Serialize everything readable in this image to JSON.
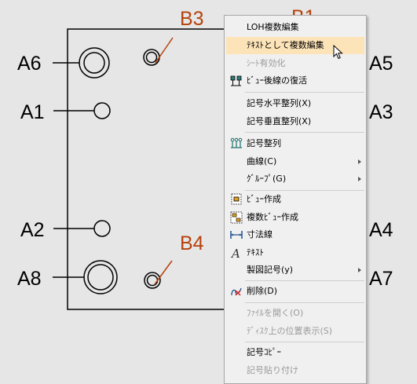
{
  "drawing": {
    "labels": {
      "a6": "A6",
      "a1": "A1",
      "a2": "A2",
      "a8": "A8",
      "a5": "A5",
      "a3": "A3",
      "a4": "A4",
      "a7": "A7",
      "b3": "B3",
      "b1": "B1",
      "b4": "B4"
    }
  },
  "menu": {
    "items": [
      {
        "label": "LOH複数編集",
        "state": "normal",
        "icon": "none",
        "submenu": false
      },
      {
        "label": "ﾃｷｽﾄとして複数編集",
        "state": "highlighted",
        "icon": "none",
        "submenu": false
      },
      {
        "label": "ｼｰﾄ有効化",
        "state": "disabled",
        "icon": "none",
        "submenu": false
      },
      {
        "label": "ﾋﾞｭｰ後線の復活",
        "state": "normal",
        "icon": "restore-lines-icon",
        "submenu": false
      },
      {
        "label": "記号水平整列(X)",
        "state": "normal",
        "icon": "none",
        "submenu": false
      },
      {
        "label": "記号垂直整列(X)",
        "state": "normal",
        "icon": "none",
        "submenu": false
      },
      {
        "label": "記号整列",
        "state": "normal",
        "icon": "align-symbols-icon",
        "submenu": false
      },
      {
        "label": "曲線(C)",
        "state": "normal",
        "icon": "none",
        "submenu": true
      },
      {
        "label": "ｸﾞﾙｰﾌﾟ(G)",
        "state": "normal",
        "icon": "none",
        "submenu": true
      },
      {
        "label": "ﾋﾞｭｰ作成",
        "state": "normal",
        "icon": "create-view-icon",
        "submenu": false
      },
      {
        "label": "複数ﾋﾞｭｰ作成",
        "state": "normal",
        "icon": "create-multi-view-icon",
        "submenu": false
      },
      {
        "label": "寸法線",
        "state": "normal",
        "icon": "dimension-line-icon",
        "submenu": false
      },
      {
        "label": "ﾃｷｽﾄ",
        "state": "normal",
        "icon": "text-icon",
        "submenu": false
      },
      {
        "label": "製図記号(y)",
        "state": "normal",
        "icon": "none",
        "submenu": true
      },
      {
        "label": "削除(D)",
        "state": "normal",
        "icon": "delete-icon",
        "submenu": false
      },
      {
        "label": "ﾌｧｲﾙを開く(O)",
        "state": "disabled",
        "icon": "none",
        "submenu": false
      },
      {
        "label": "ﾃﾞｨｽｸ上の位置表示(S)",
        "state": "disabled",
        "icon": "none",
        "submenu": false
      },
      {
        "label": "記号ｺﾋﾟｰ",
        "state": "normal",
        "icon": "none",
        "submenu": false
      },
      {
        "label": "記号貼り付け",
        "state": "disabled",
        "icon": "none",
        "submenu": false
      }
    ]
  },
  "colors": {
    "annotation": "#b5420c",
    "highlight": "#fde3b8",
    "menu_bg": "#f0f0f0",
    "disabled_text": "#9a9a9a"
  }
}
